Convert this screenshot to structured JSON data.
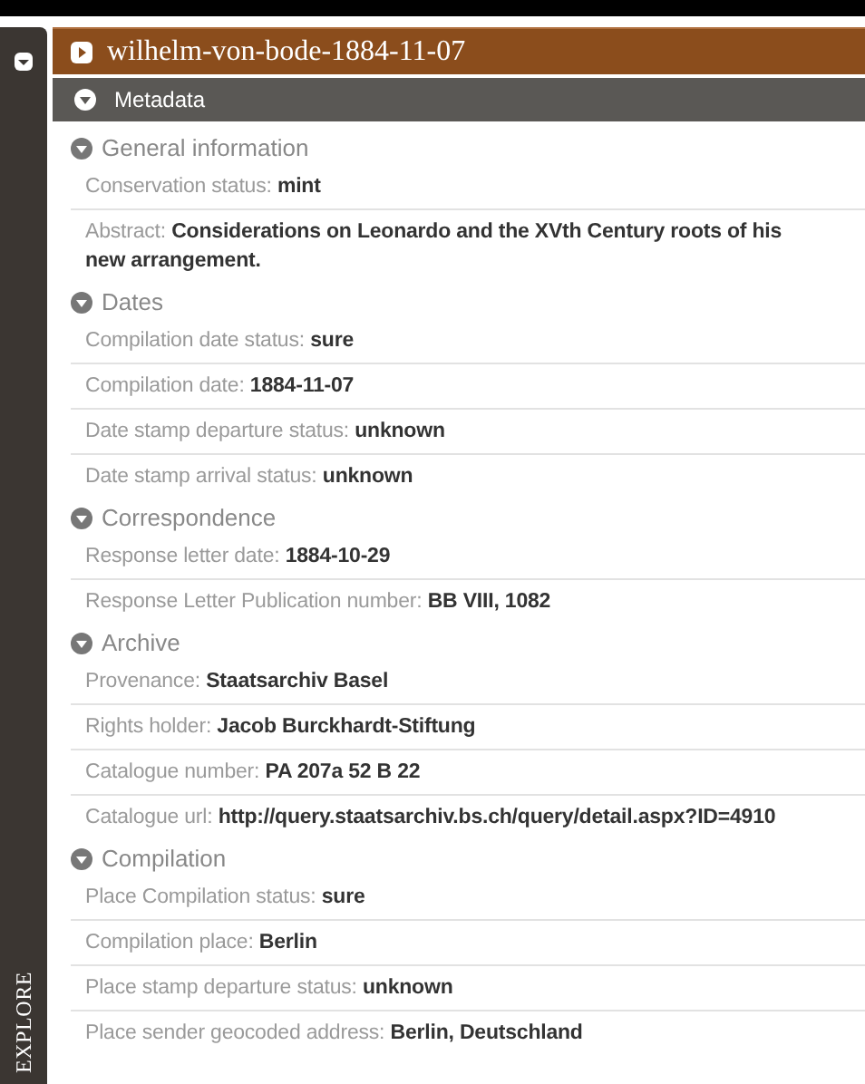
{
  "sidebar": {
    "label": "EXPLORE"
  },
  "panel": {
    "title": "wilhelm-von-bode-1884-11-07",
    "expanded": false
  },
  "metadata": {
    "title": "Metadata",
    "expanded": true,
    "sections": [
      {
        "title": "General information",
        "expanded": true,
        "fields": [
          {
            "label": "Conservation status:",
            "value": [
              "mint"
            ]
          },
          {
            "label": "Abstract:",
            "value": [
              "Considerations on Leonardo and the XVth Century roots of his",
              "new arrangement."
            ]
          }
        ]
      },
      {
        "title": "Dates",
        "expanded": true,
        "fields": [
          {
            "label": "Compilation date status:",
            "value": [
              "sure"
            ]
          },
          {
            "label": "Compilation date:",
            "value": [
              "1884-11-07"
            ]
          },
          {
            "label": "Date stamp departure status:",
            "value": [
              "unknown"
            ]
          },
          {
            "label": "Date stamp arrival status:",
            "value": [
              "unknown"
            ]
          }
        ]
      },
      {
        "title": "Correspondence",
        "expanded": true,
        "fields": [
          {
            "label": "Response letter date:",
            "value": [
              "1884-10-29"
            ]
          },
          {
            "label": "Response Letter Publication number:",
            "value": [
              "BB VIII, 1082"
            ]
          }
        ]
      },
      {
        "title": "Archive",
        "expanded": true,
        "fields": [
          {
            "label": "Provenance:",
            "value": [
              "Staatsarchiv Basel"
            ]
          },
          {
            "label": "Rights holder:",
            "value": [
              "Jacob Burckhardt-Stiftung"
            ]
          },
          {
            "label": "Catalogue number:",
            "value": [
              "PA 207a 52 B 22"
            ]
          },
          {
            "label": "Catalogue url:",
            "value": [
              "http://query.staatsarchiv.bs.ch/query/detail.aspx?ID=4910"
            ]
          }
        ]
      },
      {
        "title": "Compilation",
        "expanded": true,
        "fields": [
          {
            "label": "Place Compilation status:",
            "value": [
              "sure"
            ]
          },
          {
            "label": "Compilation place:",
            "value": [
              "Berlin"
            ]
          },
          {
            "label": "Place stamp departure status:",
            "value": [
              "unknown"
            ]
          },
          {
            "label": "Place sender geocoded address:",
            "value": [
              "Berlin, Deutschland"
            ]
          }
        ]
      }
    ]
  }
}
